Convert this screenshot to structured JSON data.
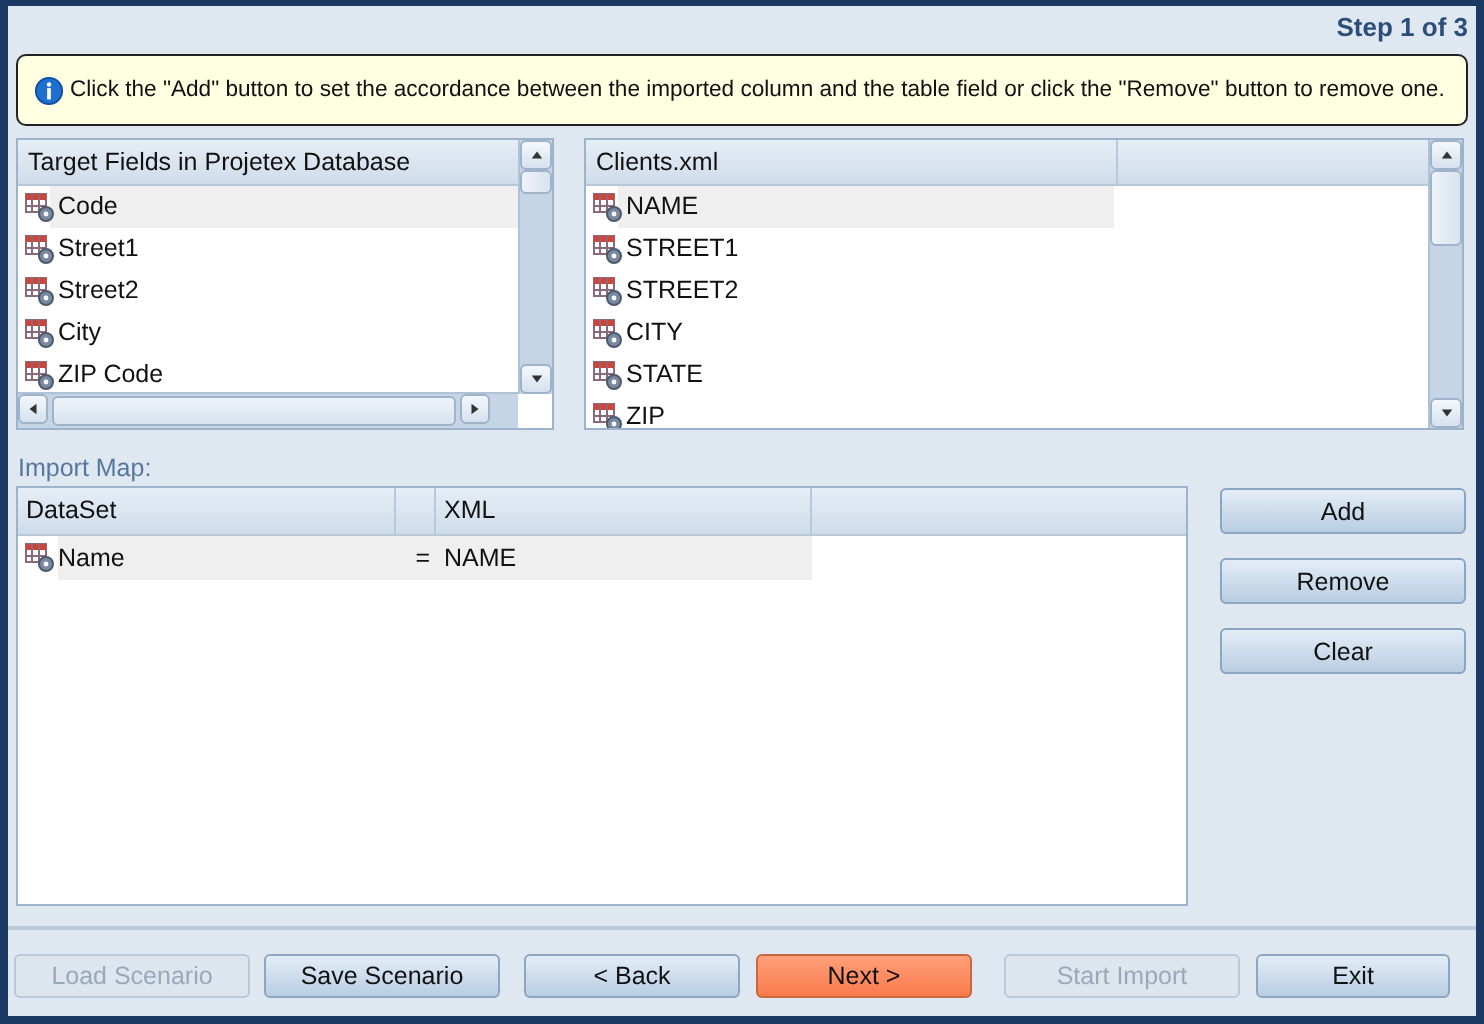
{
  "step": "Step 1 of 3",
  "info": "Click the \"Add\" button to set the accordance between the imported column and the table field or click the \"Remove\" button to remove one.",
  "target_list": {
    "header": "Target Fields in Projetex Database",
    "items": [
      {
        "label": "Code",
        "selected": true
      },
      {
        "label": "Street1",
        "selected": false
      },
      {
        "label": "Street2",
        "selected": false
      },
      {
        "label": "City",
        "selected": false
      },
      {
        "label": "ZIP Code",
        "selected": false
      }
    ]
  },
  "source_list": {
    "header": "Clients.xml",
    "items": [
      {
        "label": "NAME",
        "selected": true
      },
      {
        "label": "STREET1",
        "selected": false
      },
      {
        "label": "STREET2",
        "selected": false
      },
      {
        "label": "CITY",
        "selected": false
      },
      {
        "label": "STATE",
        "selected": false
      },
      {
        "label": "ZIP",
        "selected": false
      }
    ]
  },
  "import_map": {
    "label": "Import Map:",
    "columns": [
      "DataSet",
      "XML"
    ],
    "rows": [
      {
        "dataset": "Name",
        "operator": "=",
        "xml": "NAME",
        "selected": true
      }
    ]
  },
  "side_buttons": [
    "Add",
    "Remove",
    "Clear"
  ],
  "bottom_buttons": [
    {
      "label": "Load Scenario",
      "kind": "normal",
      "disabled": true
    },
    {
      "label": "Save Scenario",
      "kind": "normal",
      "disabled": false
    },
    {
      "label": "< Back",
      "kind": "normal",
      "disabled": false
    },
    {
      "label": "Next >",
      "kind": "primary",
      "disabled": false
    },
    {
      "label": "Start Import",
      "kind": "normal",
      "disabled": true
    },
    {
      "label": "Exit",
      "kind": "normal",
      "disabled": false
    }
  ]
}
